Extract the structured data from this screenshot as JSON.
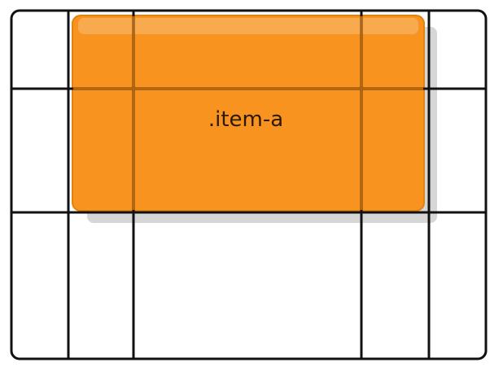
{
  "diagram": {
    "item_label": ".item-a",
    "colors": {
      "grid_line": "#111111",
      "item_fill": "#f7931e",
      "item_border": "#e2820f",
      "item_shadow": "#cfcfcf",
      "label": "#2a1a0a",
      "background": "#ffffff"
    }
  }
}
